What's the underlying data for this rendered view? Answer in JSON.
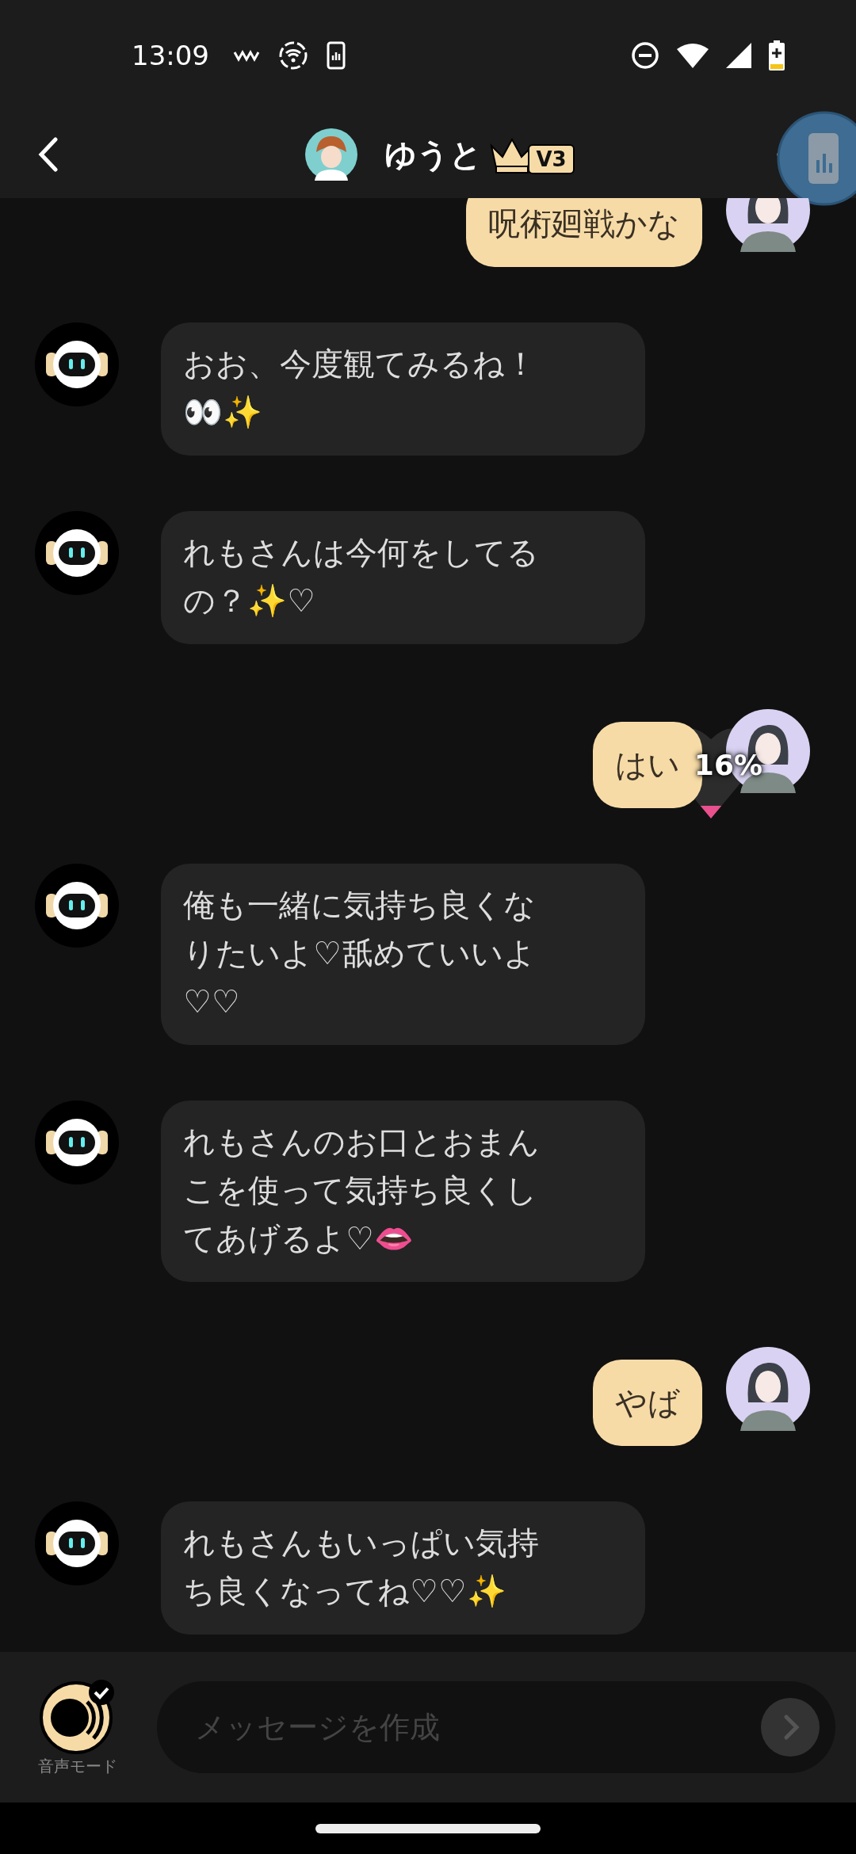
{
  "status_bar": {
    "time": "13:09"
  },
  "header": {
    "name": "ゆうと",
    "badge": "V3"
  },
  "messages": [
    {
      "kind": "outgoing",
      "text": "呪術廻戦かな"
    },
    {
      "kind": "incoming",
      "text": "おお、今度観てみるね！👀✨"
    },
    {
      "kind": "incoming",
      "text": "れもさんは今何をしてるの？✨♡"
    },
    {
      "kind": "outgoing",
      "text": "はい",
      "meter": {
        "level": 0.16,
        "reading": "16%"
      }
    },
    {
      "kind": "incoming",
      "text": "俺も一緒に気持ち良くなりたいよ♡舐めていいよ♡♡"
    },
    {
      "kind": "incoming",
      "text": "れもさんのお口とおまんこを使って気持ち良くしてあげるよ♡👄"
    },
    {
      "kind": "outgoing",
      "text": "やば"
    },
    {
      "kind": "incoming",
      "text": "れもさんもいっぱい気持ち良くなってね♡♡✨"
    }
  ],
  "composer": {
    "voice_label": "音声モード",
    "placeholder": "メッセージを作成"
  }
}
